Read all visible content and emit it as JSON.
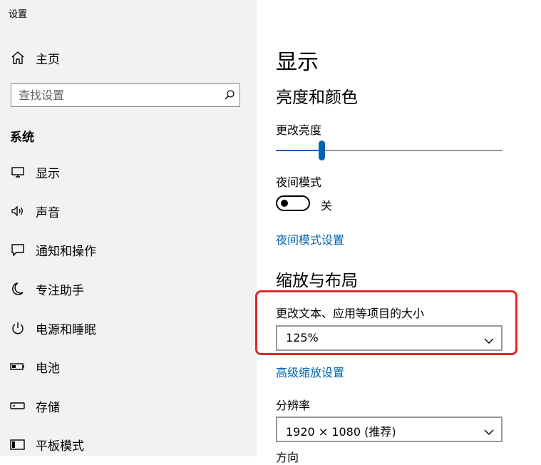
{
  "window": {
    "title": "设置"
  },
  "sidebar": {
    "home_label": "主页",
    "search": {
      "placeholder": "查找设置"
    },
    "section_label": "系统",
    "items": [
      {
        "label": "显示",
        "icon": "monitor-icon"
      },
      {
        "label": "声音",
        "icon": "speaker-icon"
      },
      {
        "label": "通知和操作",
        "icon": "notification-icon"
      },
      {
        "label": "专注助手",
        "icon": "moon-icon"
      },
      {
        "label": "电源和睡眠",
        "icon": "power-icon"
      },
      {
        "label": "电池",
        "icon": "battery-icon"
      },
      {
        "label": "存储",
        "icon": "storage-icon"
      },
      {
        "label": "平板模式",
        "icon": "tablet-icon"
      }
    ]
  },
  "main": {
    "title": "显示",
    "brightness_section": {
      "heading": "亮度和颜色",
      "brightness_label": "更改亮度",
      "brightness_value": 0.2,
      "night_mode_label": "夜间模式",
      "night_mode_state": "关",
      "night_mode_link": "夜间模式设置"
    },
    "layout_section": {
      "heading": "缩放与布局",
      "scale_label": "更改文本、应用等项目的大小",
      "scale_value": "125%",
      "advanced_link": "高级缩放设置",
      "resolution_label": "分辨率",
      "resolution_value": "1920 × 1080 (推荐)",
      "cut_label": "方向"
    }
  },
  "colors": {
    "accent": "#0063b1",
    "highlight": "#e0262b",
    "sidebar_bg": "#f2f2f2"
  }
}
